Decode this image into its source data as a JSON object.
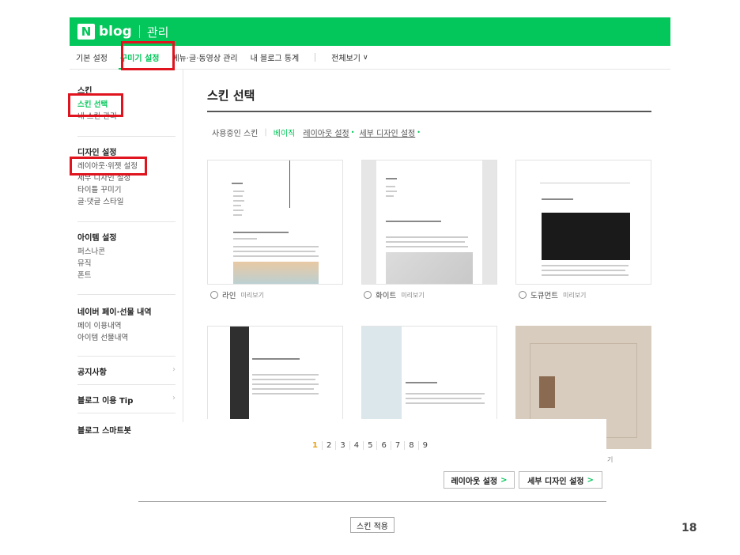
{
  "header": {
    "logo_n": "N",
    "logo_blog": "blog",
    "manage_label": "관리"
  },
  "nav": {
    "items": [
      {
        "label": "기본 설정"
      },
      {
        "label": "꾸미기 설정"
      },
      {
        "label": "메뉴·글·동영상 관리"
      },
      {
        "label": "내 블로그 통계"
      },
      {
        "label": "전체보기"
      }
    ],
    "chevron": "∨"
  },
  "sidebar": {
    "skin": {
      "head": "스킨",
      "items": [
        "스킨 선택",
        "내 스킨 관리"
      ]
    },
    "design": {
      "head": "디자인 설정",
      "items": [
        "레이아웃·위젯 설정",
        "세부 디자인 설정",
        "타이틀 꾸미기",
        "글·댓글 스타일"
      ]
    },
    "item_settings": {
      "head": "아이템 설정",
      "items": [
        "퍼스나콘",
        "뮤직",
        "폰트"
      ]
    },
    "pay": {
      "head": "네이버 페이·선물 내역",
      "items": [
        "페이 이용내역",
        "아이템 선물내역"
      ]
    },
    "links": [
      "공지사항",
      "블로그 이용 Tip",
      "블로그 스마트봇"
    ],
    "arrow": "›"
  },
  "main": {
    "title": "스킨 선택",
    "filter": {
      "label": "사용중인 스킨",
      "current": "베이직",
      "layout_link": "레이아웃 설정",
      "detail_link": "세부 디자인 설정",
      "dot": "•"
    },
    "skins": [
      {
        "name": "라인",
        "preview": "미리보기"
      },
      {
        "name": "화이트",
        "preview": "미리보기"
      },
      {
        "name": "도큐먼트",
        "preview": "미리보기"
      }
    ],
    "pagination": [
      "1",
      "2",
      "3",
      "4",
      "5",
      "6",
      "7",
      "8",
      "9"
    ],
    "stray_text": "기",
    "layout_button": "레이아웃 설정",
    "detail_button": "세부 디자인 설정",
    "button_arrow": ">",
    "apply_button": "스킨 적용"
  },
  "slide_number": "18",
  "colors": {
    "brand_green": "#03c75a",
    "highlight_red": "#e0141e",
    "active_page": "#e8a214"
  }
}
